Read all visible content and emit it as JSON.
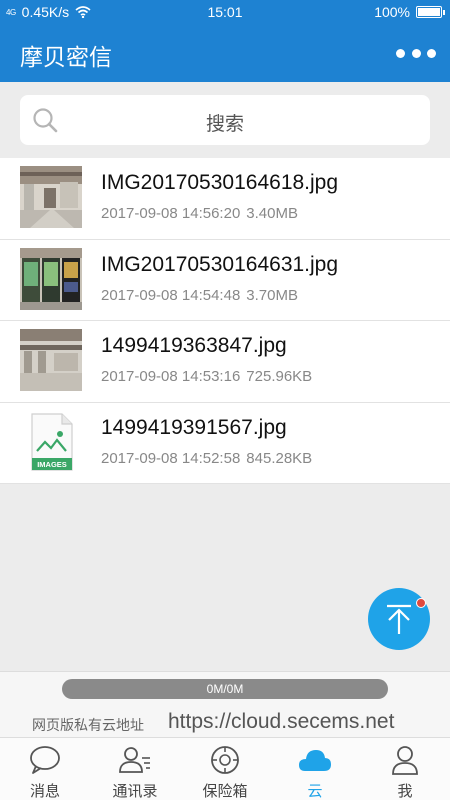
{
  "status_bar": {
    "signal": "4G",
    "speed": "0.45K/s",
    "time": "15:01",
    "battery": "100%"
  },
  "app_bar": {
    "title": "摩贝密信",
    "more_icon": "more-dots-icon"
  },
  "search": {
    "placeholder": "搜索",
    "icon": "search-icon"
  },
  "files": [
    {
      "name": "IMG20170530164618.jpg",
      "date": "2017-09-08 14:56:20",
      "size": "3.40MB",
      "thumb": "photo-lobby"
    },
    {
      "name": "IMG20170530164631.jpg",
      "date": "2017-09-08 14:54:48",
      "size": "3.70MB",
      "thumb": "photo-vending-machines"
    },
    {
      "name": "1499419363847.jpg",
      "date": "2017-09-08 14:53:16",
      "size": "725.96KB",
      "thumb": "photo-atrium"
    },
    {
      "name": "1499419391567.jpg",
      "date": "2017-09-08 14:52:58",
      "size": "845.28KB",
      "thumb": "images-file-icon",
      "thumb_label": "IMAGES"
    }
  ],
  "storage": {
    "progress_text": "0M/0M",
    "progress_fraction": 0,
    "url_label": "网页版私有云地址",
    "url": "https://cloud.secems.net"
  },
  "tabs": [
    {
      "label": "消息",
      "icon": "chat-bubble-icon",
      "active": false
    },
    {
      "label": "通讯录",
      "icon": "contacts-icon",
      "active": false
    },
    {
      "label": "保险箱",
      "icon": "safe-icon",
      "active": false
    },
    {
      "label": "云",
      "icon": "cloud-icon",
      "active": true
    },
    {
      "label": "我",
      "icon": "person-icon",
      "active": false
    }
  ],
  "colors": {
    "primary": "#1e82d2",
    "accent": "#1fa3e8",
    "badge": "#e04a3f"
  }
}
